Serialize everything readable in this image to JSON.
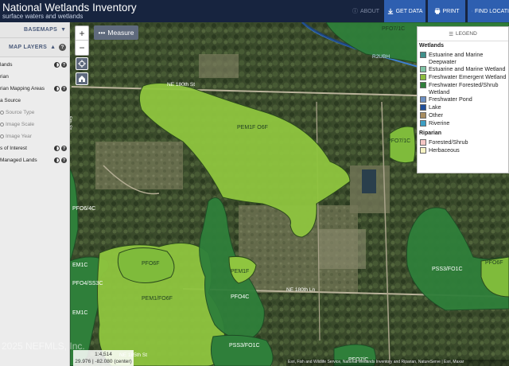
{
  "header": {
    "title": "National Wetlands Inventory",
    "subtitle": "surface waters and wetlands",
    "about_label": "ABOUT",
    "get_data_label": "GET DATA",
    "print_label": "PRINT",
    "find_location_label": "FIND LOCATI"
  },
  "panel": {
    "basemaps_label": "BASEMAPS",
    "map_layers_label": "MAP LAYERS",
    "layers": [
      {
        "label": "lands"
      },
      {
        "label": "rian"
      },
      {
        "label": "rian Mapping Areas"
      },
      {
        "label": "a Source"
      },
      {
        "label": "Source Type"
      },
      {
        "label": "Image Scale"
      },
      {
        "label": "Image Year"
      },
      {
        "label": "s of Interest"
      },
      {
        "label": "Managed Lands"
      }
    ]
  },
  "map": {
    "measure_label": "Measure",
    "zoom_in": "+",
    "zoom_out": "−",
    "roads": {
      "road1": "NE 180th St",
      "road2": "NE 180th Ln",
      "road3": "5th St",
      "road4": "NE 185th St"
    },
    "polygon_labels": {
      "pem1": "PEM1F O6F",
      "pfo7a": "PFO7/1C",
      "pfo7b": "PFO7/1C",
      "pfo6a": "PFO6/4C",
      "em1c": "EM1C",
      "pfo4": "PFO4/SS3C",
      "em1c2": "EM1C",
      "pfo6f": "PFO6F",
      "pem1f": "PEM1F",
      "pem1fo6f": "PEM1/FO6F",
      "pfo4c": "PFO4C",
      "pss3": "PSS3/FO1C",
      "pss3b": "PSS3/FO1C",
      "pfo6fr": "PFO6F",
      "r2ubh": "R2UBH",
      "pfo7c": "PFO7/C"
    },
    "scale_text": "1:4,514",
    "coord_text": "29.976 | -82.080 (center)",
    "watermark": "2025 NEFMLS, Inc.",
    "attribution": "Esri, Fish and Wildlife Service, National Wetlands Inventory and Riparian, NatureServe | Esri, Maxar"
  },
  "legend": {
    "tab_label": "LEGEND",
    "wetlands_title": "Wetlands",
    "wetlands": [
      {
        "label": "Estuarine and Marine Deepwater",
        "color": "#3f8f8a"
      },
      {
        "label": "Estuarine and Marine Wetland",
        "color": "#7fc3a4"
      },
      {
        "label": "Freshwater Emergent Wetland",
        "color": "#8cbb3e"
      },
      {
        "label": "Freshwater Forested/Shrub Wetland",
        "color": "#2f7f3a"
      },
      {
        "label": "Freshwater Pond",
        "color": "#6c8fc2"
      },
      {
        "label": "Lake",
        "color": "#1f4e9a"
      },
      {
        "label": "Other",
        "color": "#a78c5f"
      },
      {
        "label": "Riverine",
        "color": "#3d9ec3"
      }
    ],
    "riparian_title": "Riparian",
    "riparian": [
      {
        "label": "Forested/Shrub",
        "color": "#f4c6c4"
      },
      {
        "label": "Herbaceous",
        "color": "#f7f3c3"
      }
    ]
  }
}
